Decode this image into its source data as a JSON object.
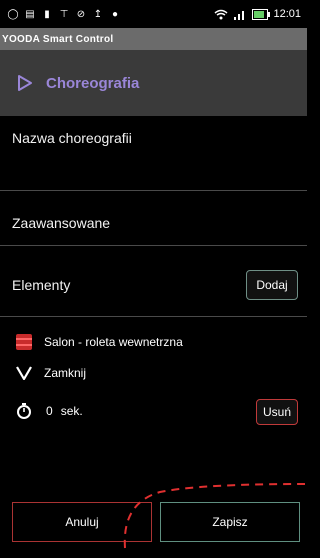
{
  "status_bar": {
    "time": "12:01",
    "signal": "…│",
    "battery_level_percent": 70,
    "left_icons": [
      "circle-icon",
      "message-icon",
      "document-icon",
      "pin-icon",
      "alarm-icon",
      "upload-icon",
      "robot-icon"
    ]
  },
  "app": {
    "window_title": "YOODA Smart Control",
    "screen_title": "Choreografia"
  },
  "form": {
    "name_placeholder": "Nazwa choreografii",
    "advanced_label": "Zaawansowane",
    "elements_label": "Elementy",
    "add_button": "Dodaj"
  },
  "element": {
    "device_name": "Salon - roleta wewnetrzna",
    "action_label": "Zamknij",
    "delay_value": "0",
    "delay_unit": "sek.",
    "remove_button": "Usuń"
  },
  "footer": {
    "cancel_button": "Anuluj",
    "save_button": "Zapisz"
  },
  "colors": {
    "accent": "#9a86d8",
    "action_bar": "#3a3a3a",
    "title_bar": "#6b6b6b",
    "cancel_border": "#aa3333",
    "save_border": "#5f8f80",
    "highlight_dash": "#e03030"
  }
}
